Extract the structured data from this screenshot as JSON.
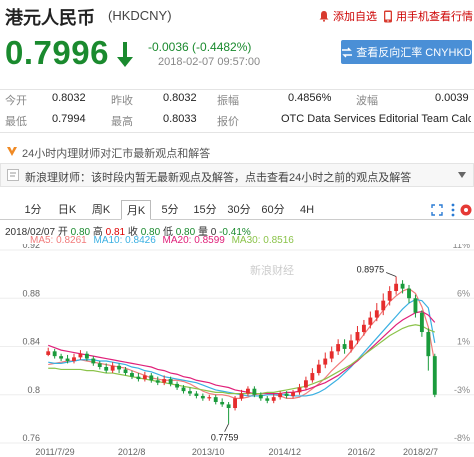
{
  "header": {
    "title": "港元人民币",
    "code": "(HKDCNY)",
    "add_watchlist": "添加自选",
    "mobile_quote": "用手机查看行情"
  },
  "quote": {
    "price": "0.7996",
    "change": "-0.0036 (-0.4482%)",
    "time": "2018-02-07 09:57:00",
    "reverse_button": "查看反向汇率 CNYHKD"
  },
  "stats": {
    "open_label": "今开",
    "open": "0.8032",
    "prev_label": "昨收",
    "prev": "0.8032",
    "amp_label": "振幅",
    "amp": "0.4856%",
    "wave_label": "波幅",
    "wave": "0.0039",
    "low_label": "最低",
    "low": "0.7994",
    "high_label": "最高",
    "high": "0.8033",
    "quote_label": "报价",
    "quote_src": "OTC Data Services Editorial Team Calc..."
  },
  "news": {
    "bar_text": "24小时内理财师对汇市最新观点和解答",
    "item_text": "新浪理财师：该时段内暂无最新观点及解答，点击查看24小时之前的观点及解答"
  },
  "tabs": [
    "1分",
    "日K",
    "周K",
    "月K",
    "5分",
    "15分",
    "30分",
    "60分",
    "4H"
  ],
  "active_tab": "月K",
  "kline_info": {
    "date": "2018/02/07",
    "open_label": "开",
    "open": "0.80",
    "high_label": "高",
    "high": "0.81",
    "close_label": "收",
    "close": "0.80",
    "low_label": "低",
    "low": "0.80",
    "vol_label": "量",
    "vol": "0",
    "change": "-0.41%"
  },
  "ma_info": {
    "ma5": "MA5: 0.8261",
    "ma10": "MA10: 0.8426",
    "ma20": "MA20: 0.8599",
    "ma30": "MA30: 0.8516"
  },
  "colors": {
    "up": "#e52d2d",
    "down": "#1a9b3c",
    "ma5": "#f27b7b",
    "ma10": "#3ab0e2",
    "ma20": "#e0207a",
    "ma30": "#8bc34a",
    "accent_blue": "#4a8fd6",
    "price_green": "#1a8a2e"
  },
  "chart_data": {
    "type": "candlestick",
    "title": "",
    "xlabel": "",
    "ylabel": "",
    "y_ticks": [
      "0.92",
      "0.88",
      "0.84",
      "0.8",
      "0.76"
    ],
    "ylim": [
      0.76,
      0.92
    ],
    "pct_ticks": [
      "11%",
      "6%",
      "1%",
      "-3%",
      "-8%"
    ],
    "x_ticks": [
      "2011/7/29",
      "2012/8",
      "2013/10",
      "2014/12",
      "2016/2",
      "2018/2/7"
    ],
    "high_annotation": "0.8975",
    "low_annotation": "0.7759",
    "watermark": "新浪财经",
    "series": [
      {
        "name": "MA5",
        "values": [
          0.825,
          0.826,
          0.827,
          0.828,
          0.828,
          0.829,
          0.828,
          0.827,
          0.826,
          0.825,
          0.824,
          0.823,
          0.822,
          0.82,
          0.818,
          0.816,
          0.814,
          0.813,
          0.812,
          0.812,
          0.812,
          0.811,
          0.809,
          0.806,
          0.803,
          0.801,
          0.8,
          0.8,
          0.799,
          0.797,
          0.797,
          0.798,
          0.8,
          0.801,
          0.801,
          0.8,
          0.799,
          0.797,
          0.797,
          0.798,
          0.801,
          0.805,
          0.809,
          0.814,
          0.82,
          0.825,
          0.83,
          0.836,
          0.843,
          0.85,
          0.857,
          0.863,
          0.87,
          0.877,
          0.882,
          0.886,
          0.888,
          0.884,
          0.873,
          0.856,
          0.826
        ]
      },
      {
        "name": "MA10",
        "values": [
          0.827,
          0.826,
          0.826,
          0.827,
          0.828,
          0.829,
          0.829,
          0.829,
          0.828,
          0.828,
          0.827,
          0.826,
          0.825,
          0.823,
          0.822,
          0.82,
          0.819,
          0.817,
          0.815,
          0.814,
          0.813,
          0.812,
          0.811,
          0.81,
          0.808,
          0.806,
          0.804,
          0.803,
          0.802,
          0.801,
          0.8,
          0.799,
          0.799,
          0.799,
          0.8,
          0.8,
          0.8,
          0.8,
          0.799,
          0.799,
          0.799,
          0.8,
          0.802,
          0.805,
          0.809,
          0.813,
          0.818,
          0.823,
          0.829,
          0.835,
          0.841,
          0.847,
          0.853,
          0.859,
          0.865,
          0.871,
          0.876,
          0.879,
          0.878,
          0.872,
          0.843
        ]
      },
      {
        "name": "MA20",
        "values": [
          0.841,
          0.839,
          0.837,
          0.836,
          0.835,
          0.834,
          0.833,
          0.832,
          0.831,
          0.83,
          0.829,
          0.828,
          0.827,
          0.826,
          0.825,
          0.824,
          0.823,
          0.821,
          0.82,
          0.818,
          0.817,
          0.815,
          0.814,
          0.812,
          0.811,
          0.81,
          0.808,
          0.807,
          0.806,
          0.804,
          0.803,
          0.802,
          0.801,
          0.801,
          0.801,
          0.801,
          0.801,
          0.802,
          0.802,
          0.803,
          0.804,
          0.806,
          0.808,
          0.81,
          0.813,
          0.816,
          0.82,
          0.824,
          0.828,
          0.833,
          0.838,
          0.843,
          0.848,
          0.853,
          0.858,
          0.862,
          0.865,
          0.868,
          0.869,
          0.866,
          0.86
        ]
      },
      {
        "name": "MA30",
        "values": [
          0.822,
          0.822,
          0.821,
          0.821,
          0.821,
          0.821,
          0.82,
          0.82,
          0.819,
          0.818,
          0.818,
          0.817,
          0.816,
          0.815,
          0.814,
          0.813,
          0.812,
          0.811,
          0.81,
          0.809,
          0.808,
          0.807,
          0.806,
          0.805,
          0.804,
          0.803,
          0.802,
          0.802,
          0.801,
          0.801,
          0.801,
          0.801,
          0.801,
          0.801,
          0.802,
          0.802,
          0.803,
          0.804,
          0.805,
          0.806,
          0.807,
          0.809,
          0.811,
          0.813,
          0.816,
          0.819,
          0.822,
          0.825,
          0.829,
          0.833,
          0.837,
          0.841,
          0.845,
          0.849,
          0.852,
          0.855,
          0.857,
          0.858,
          0.857,
          0.854,
          0.852
        ]
      }
    ],
    "candles": [
      [
        0.833,
        0.836,
        0.839,
        0.832
      ],
      [
        0.836,
        0.832,
        0.838,
        0.83
      ],
      [
        0.832,
        0.83,
        0.834,
        0.828
      ],
      [
        0.83,
        0.828,
        0.833,
        0.826
      ],
      [
        0.828,
        0.831,
        0.834,
        0.826
      ],
      [
        0.831,
        0.834,
        0.837,
        0.829
      ],
      [
        0.834,
        0.83,
        0.836,
        0.828
      ],
      [
        0.83,
        0.826,
        0.832,
        0.824
      ],
      [
        0.826,
        0.823,
        0.828,
        0.821
      ],
      [
        0.823,
        0.82,
        0.826,
        0.818
      ],
      [
        0.82,
        0.824,
        0.827,
        0.818
      ],
      [
        0.824,
        0.821,
        0.826,
        0.818
      ],
      [
        0.821,
        0.818,
        0.823,
        0.816
      ],
      [
        0.818,
        0.815,
        0.82,
        0.813
      ],
      [
        0.815,
        0.813,
        0.818,
        0.811
      ],
      [
        0.813,
        0.816,
        0.819,
        0.811
      ],
      [
        0.816,
        0.812,
        0.818,
        0.81
      ],
      [
        0.812,
        0.81,
        0.815,
        0.808
      ],
      [
        0.81,
        0.813,
        0.816,
        0.808
      ],
      [
        0.813,
        0.809,
        0.815,
        0.807
      ],
      [
        0.809,
        0.806,
        0.811,
        0.804
      ],
      [
        0.806,
        0.803,
        0.808,
        0.801
      ],
      [
        0.803,
        0.801,
        0.806,
        0.799
      ],
      [
        0.801,
        0.799,
        0.803,
        0.797
      ],
      [
        0.799,
        0.797,
        0.801,
        0.795
      ],
      [
        0.797,
        0.798,
        0.8,
        0.795
      ],
      [
        0.798,
        0.794,
        0.8,
        0.792
      ],
      [
        0.794,
        0.792,
        0.797,
        0.79
      ],
      [
        0.792,
        0.789,
        0.794,
        0.776
      ],
      [
        0.789,
        0.797,
        0.799,
        0.787
      ],
      [
        0.797,
        0.801,
        0.804,
        0.795
      ],
      [
        0.801,
        0.805,
        0.807,
        0.799
      ],
      [
        0.805,
        0.8,
        0.807,
        0.798
      ],
      [
        0.8,
        0.797,
        0.802,
        0.795
      ],
      [
        0.797,
        0.795,
        0.799,
        0.793
      ],
      [
        0.795,
        0.798,
        0.801,
        0.793
      ],
      [
        0.798,
        0.801,
        0.803,
        0.796
      ],
      [
        0.801,
        0.799,
        0.803,
        0.797
      ],
      [
        0.799,
        0.802,
        0.804,
        0.797
      ],
      [
        0.802,
        0.806,
        0.809,
        0.8
      ],
      [
        0.806,
        0.812,
        0.815,
        0.804
      ],
      [
        0.812,
        0.818,
        0.822,
        0.81
      ],
      [
        0.818,
        0.825,
        0.829,
        0.816
      ],
      [
        0.825,
        0.83,
        0.835,
        0.822
      ],
      [
        0.83,
        0.836,
        0.84,
        0.827
      ],
      [
        0.836,
        0.842,
        0.846,
        0.833
      ],
      [
        0.842,
        0.838,
        0.846,
        0.834
      ],
      [
        0.838,
        0.845,
        0.85,
        0.835
      ],
      [
        0.845,
        0.852,
        0.857,
        0.842
      ],
      [
        0.852,
        0.858,
        0.862,
        0.849
      ],
      [
        0.858,
        0.864,
        0.869,
        0.855
      ],
      [
        0.864,
        0.87,
        0.876,
        0.861
      ],
      [
        0.87,
        0.878,
        0.884,
        0.866
      ],
      [
        0.878,
        0.886,
        0.89,
        0.874
      ],
      [
        0.886,
        0.892,
        0.898,
        0.883
      ],
      [
        0.892,
        0.888,
        0.895,
        0.884
      ],
      [
        0.888,
        0.88,
        0.891,
        0.876
      ],
      [
        0.88,
        0.868,
        0.883,
        0.864
      ],
      [
        0.868,
        0.852,
        0.87,
        0.848
      ],
      [
        0.852,
        0.832,
        0.855,
        0.82
      ],
      [
        0.832,
        0.8,
        0.834,
        0.798
      ]
    ]
  }
}
